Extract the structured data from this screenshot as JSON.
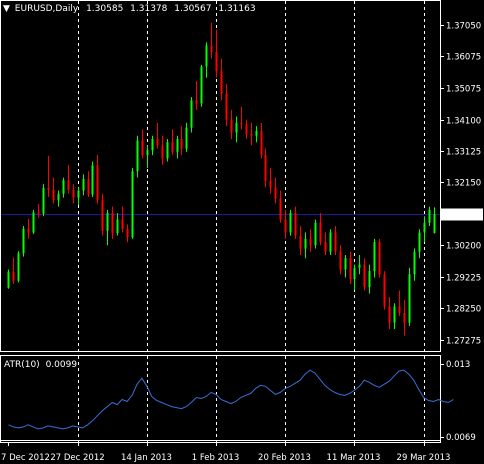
{
  "header": {
    "symbol": "EURUSD,Daily",
    "open": "1.30585",
    "high": "1.31378",
    "low": "1.30567",
    "close": "1.31163"
  },
  "indicator": {
    "name": "ATR(10)",
    "value": "0.0099",
    "max_label": "0.013",
    "min_label": "0.0069"
  },
  "colors": {
    "background": "#000000",
    "bull": "#00ff00",
    "bear": "#ff0000",
    "grid": "#ffffff",
    "atr_line": "#3a6fd8",
    "price_line": "#1a1aa0"
  },
  "chart_data": [
    {
      "type": "candlestick",
      "title": "EURUSD,Daily",
      "y_ticks": [
        "1.37050",
        "1.36075",
        "1.35075",
        "1.34100",
        "1.33125",
        "1.32150",
        "1.31163",
        "1.30200",
        "1.29225",
        "1.28250",
        "1.27275"
      ],
      "ylim": [
        1.2695,
        1.3738
      ],
      "current_price": 1.31163,
      "x_ticks": [
        "7 Dec 2012",
        "27 Dec 2012",
        "14 Jan 2013",
        "1 Feb 2013",
        "20 Feb 2013",
        "11 Mar 2013",
        "29 Mar 2013"
      ],
      "grid": "vertical dashed",
      "candles": [
        [
          1.2888,
          1.2945,
          1.2885,
          1.2938
        ],
        [
          1.2938,
          1.2982,
          1.29,
          1.291
        ],
        [
          1.291,
          1.3002,
          1.2905,
          1.2995
        ],
        [
          1.2995,
          1.308,
          1.2985,
          1.3072
        ],
        [
          1.3072,
          1.3102,
          1.304,
          1.306
        ],
        [
          1.306,
          1.313,
          1.3055,
          1.3122
        ],
        [
          1.3122,
          1.3148,
          1.3105,
          1.3118
        ],
        [
          1.3118,
          1.321,
          1.311,
          1.3198
        ],
        [
          1.3198,
          1.3298,
          1.317,
          1.3192
        ],
        [
          1.3192,
          1.323,
          1.315,
          1.316
        ],
        [
          1.316,
          1.319,
          1.314,
          1.318
        ],
        [
          1.318,
          1.323,
          1.3168,
          1.3222
        ],
        [
          1.3222,
          1.327,
          1.318,
          1.3192
        ],
        [
          1.3192,
          1.321,
          1.315,
          1.3168
        ],
        [
          1.3168,
          1.32,
          1.3145,
          1.319
        ],
        [
          1.319,
          1.324,
          1.3175,
          1.3226
        ],
        [
          1.3226,
          1.325,
          1.317,
          1.3178
        ],
        [
          1.3178,
          1.328,
          1.317,
          1.3268
        ],
        [
          1.3268,
          1.33,
          1.315,
          1.316
        ],
        [
          1.316,
          1.318,
          1.305,
          1.3065
        ],
        [
          1.3065,
          1.313,
          1.302,
          1.312
        ],
        [
          1.312,
          1.314,
          1.304,
          1.3058
        ],
        [
          1.3058,
          1.312,
          1.305,
          1.31
        ],
        [
          1.31,
          1.314,
          1.306,
          1.307
        ],
        [
          1.307,
          1.3085,
          1.303,
          1.3045
        ],
        [
          1.3045,
          1.326,
          1.304,
          1.325
        ],
        [
          1.325,
          1.336,
          1.323,
          1.3345
        ],
        [
          1.3345,
          1.338,
          1.329,
          1.33
        ],
        [
          1.33,
          1.333,
          1.326,
          1.3315
        ],
        [
          1.3315,
          1.336,
          1.33,
          1.335
        ],
        [
          1.335,
          1.34,
          1.332,
          1.333
        ],
        [
          1.333,
          1.336,
          1.327,
          1.329
        ],
        [
          1.329,
          1.335,
          1.328,
          1.334
        ],
        [
          1.334,
          1.338,
          1.33,
          1.331
        ],
        [
          1.331,
          1.336,
          1.329,
          1.335
        ],
        [
          1.335,
          1.339,
          1.33,
          1.332
        ],
        [
          1.332,
          1.34,
          1.331,
          1.3385
        ],
        [
          1.3385,
          1.348,
          1.337,
          1.347
        ],
        [
          1.347,
          1.353,
          1.344,
          1.346
        ],
        [
          1.346,
          1.358,
          1.345,
          1.3575
        ],
        [
          1.3575,
          1.365,
          1.354,
          1.364
        ],
        [
          1.364,
          1.371,
          1.36,
          1.362
        ],
        [
          1.362,
          1.369,
          1.354,
          1.356
        ],
        [
          1.356,
          1.36,
          1.347,
          1.349
        ],
        [
          1.349,
          1.352,
          1.339,
          1.341
        ],
        [
          1.341,
          1.344,
          1.335,
          1.337
        ],
        [
          1.337,
          1.342,
          1.334,
          1.34
        ],
        [
          1.34,
          1.345,
          1.338,
          1.3395
        ],
        [
          1.3395,
          1.341,
          1.335,
          1.3365
        ],
        [
          1.3365,
          1.34,
          1.333,
          1.336
        ],
        [
          1.336,
          1.339,
          1.334,
          1.3375
        ],
        [
          1.3375,
          1.34,
          1.329,
          1.33
        ],
        [
          1.33,
          1.332,
          1.32,
          1.322
        ],
        [
          1.322,
          1.326,
          1.318,
          1.32
        ],
        [
          1.32,
          1.323,
          1.315,
          1.3165
        ],
        [
          1.3165,
          1.319,
          1.309,
          1.31
        ],
        [
          1.31,
          1.313,
          1.304,
          1.306
        ],
        [
          1.306,
          1.313,
          1.305,
          1.312
        ],
        [
          1.312,
          1.314,
          1.304,
          1.305
        ],
        [
          1.305,
          1.308,
          1.299,
          1.301
        ],
        [
          1.301,
          1.306,
          1.298,
          1.304
        ],
        [
          1.304,
          1.307,
          1.3,
          1.302
        ],
        [
          1.302,
          1.31,
          1.301,
          1.309
        ],
        [
          1.309,
          1.312,
          1.302,
          1.303
        ],
        [
          1.303,
          1.306,
          1.299,
          1.3
        ],
        [
          1.3,
          1.307,
          1.299,
          1.306
        ],
        [
          1.306,
          1.308,
          1.299,
          1.3
        ],
        [
          1.3,
          1.302,
          1.293,
          1.2945
        ],
        [
          1.2945,
          1.299,
          1.292,
          1.298
        ],
        [
          1.298,
          1.3,
          1.29,
          1.2915
        ],
        [
          1.2915,
          1.296,
          1.288,
          1.295
        ],
        [
          1.295,
          1.299,
          1.293,
          1.296
        ],
        [
          1.296,
          1.298,
          1.288,
          1.289
        ],
        [
          1.289,
          1.296,
          1.287,
          1.294
        ],
        [
          1.294,
          1.304,
          1.292,
          1.303
        ],
        [
          1.303,
          1.304,
          1.292,
          1.293
        ],
        [
          1.293,
          1.294,
          1.282,
          1.283
        ],
        [
          1.283,
          1.286,
          1.276,
          1.278
        ],
        [
          1.278,
          1.284,
          1.276,
          1.283
        ],
        [
          1.283,
          1.288,
          1.28,
          1.281
        ],
        [
          1.281,
          1.285,
          1.274,
          1.278
        ],
        [
          1.278,
          1.295,
          1.277,
          1.293
        ],
        [
          1.293,
          1.301,
          1.291,
          1.3
        ],
        [
          1.3,
          1.307,
          1.298,
          1.306
        ],
        [
          1.306,
          1.311,
          1.303,
          1.309
        ],
        [
          1.309,
          1.314,
          1.308,
          1.313
        ],
        [
          1.30585,
          1.31378,
          1.30567,
          1.31163
        ]
      ]
    },
    {
      "type": "line",
      "title": "ATR(10) 0.0099",
      "y_ticks": [
        "0.013",
        "0.0069"
      ],
      "ylim": [
        0.0062,
        0.0136
      ],
      "series": [
        {
          "values": [
            0.0074,
            0.0072,
            0.0071,
            0.0072,
            0.0074,
            0.0072,
            0.007,
            0.0071,
            0.0073,
            0.0072,
            0.0071,
            0.007,
            0.0071,
            0.0073,
            0.0072,
            0.0071,
            0.0074,
            0.0078,
            0.0083,
            0.0088,
            0.0092,
            0.0096,
            0.0094,
            0.0099,
            0.0097,
            0.0103,
            0.0114,
            0.012,
            0.0112,
            0.0102,
            0.0098,
            0.0096,
            0.0094,
            0.0092,
            0.0091,
            0.009,
            0.0092,
            0.0096,
            0.0101,
            0.01,
            0.0102,
            0.0106,
            0.0104,
            0.0099,
            0.0097,
            0.0095,
            0.0097,
            0.0101,
            0.0103,
            0.0105,
            0.011,
            0.0113,
            0.0112,
            0.0108,
            0.0104,
            0.0106,
            0.011,
            0.0112,
            0.0115,
            0.0118,
            0.0124,
            0.0128,
            0.0125,
            0.0119,
            0.0113,
            0.0109,
            0.0106,
            0.0104,
            0.0103,
            0.0105,
            0.0108,
            0.0112,
            0.0118,
            0.0116,
            0.0113,
            0.0111,
            0.0114,
            0.0117,
            0.0122,
            0.0127,
            0.0128,
            0.0124,
            0.0118,
            0.0109,
            0.0101,
            0.0098,
            0.0097,
            0.0099,
            0.0097,
            0.0096,
            0.0099
          ]
        }
      ]
    }
  ]
}
